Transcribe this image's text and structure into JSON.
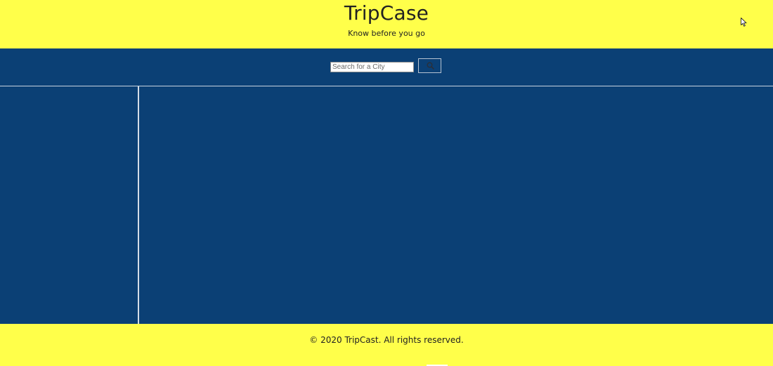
{
  "header": {
    "title": "TripCase",
    "tagline": "Know before you go"
  },
  "search": {
    "placeholder": "Search for a City",
    "value": "",
    "button_icon": "search-icon"
  },
  "footer": {
    "copyright": "© 2020 TripCast. All rights reserved."
  },
  "colors": {
    "header_bg": "#ffff4a",
    "body_bg": "#0b4075",
    "divider": "#d5dde7"
  }
}
